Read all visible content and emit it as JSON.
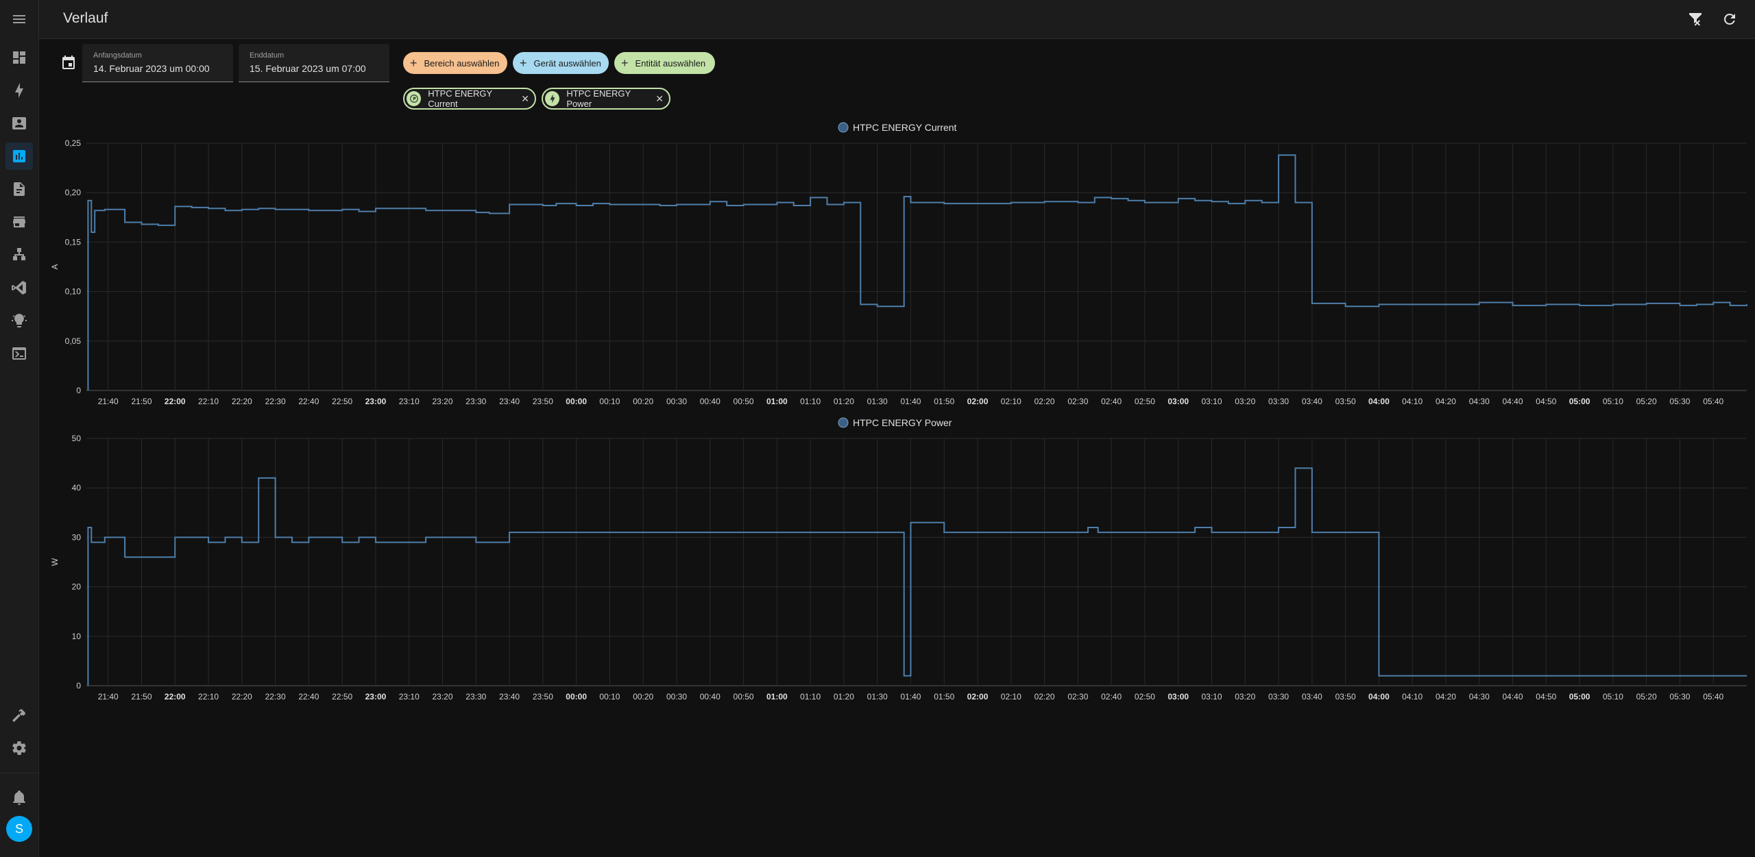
{
  "header": {
    "title": "Verlauf"
  },
  "sidebar": {
    "items": [
      {
        "name": "sidebar-item-overview",
        "icon": "dashboard-icon"
      },
      {
        "name": "sidebar-item-energy",
        "icon": "lightning-icon"
      },
      {
        "name": "sidebar-item-logbook",
        "icon": "account-box-icon"
      },
      {
        "name": "sidebar-item-history",
        "icon": "chart-box-icon",
        "active": true
      },
      {
        "name": "sidebar-item-file-editor",
        "icon": "file-document-icon"
      },
      {
        "name": "sidebar-item-store",
        "icon": "store-icon"
      },
      {
        "name": "sidebar-item-network",
        "icon": "sitemap-icon"
      },
      {
        "name": "sidebar-item-vscode",
        "icon": "code-icon"
      },
      {
        "name": "sidebar-item-lights",
        "icon": "lightbulb-icon"
      },
      {
        "name": "sidebar-item-terminal",
        "icon": "terminal-icon"
      }
    ],
    "bottom": [
      {
        "name": "sidebar-item-developer-tools",
        "icon": "hammer-icon"
      },
      {
        "name": "sidebar-item-settings",
        "icon": "gear-icon"
      },
      {
        "name": "sidebar-item-notifications",
        "icon": "bell-icon"
      }
    ],
    "user_initial": "S"
  },
  "dates": {
    "start_label": "Anfangsdatum",
    "start_value": "14. Februar 2023 um 00:00",
    "end_label": "Enddatum",
    "end_value": "15. Februar 2023 um 07:00"
  },
  "targets": {
    "area_label": "Bereich auswählen",
    "device_label": "Gerät auswählen",
    "entity_label": "Entität auswählen",
    "selected": [
      "HTPC ENERGY Current",
      "HTPC ENERGY Power"
    ]
  },
  "colors": {
    "accent": "#03a9f4",
    "series": "#4e7fab",
    "chip_area": "#f6c08f",
    "chip_device": "#a7d9f0",
    "chip_entity": "#c3e2a7"
  },
  "chart_data": [
    {
      "type": "line",
      "step": true,
      "legend": "HTPC ENERGY Current",
      "ylabel": "A",
      "ylim": [
        0,
        0.25
      ],
      "yticks": [
        "0",
        "0,05",
        "0,10",
        "0,15",
        "0,20",
        "0,25"
      ],
      "xticks": [
        "21:40",
        "21:50",
        "22:00",
        "22:10",
        "22:20",
        "22:30",
        "22:40",
        "22:50",
        "23:00",
        "23:10",
        "23:20",
        "23:30",
        "23:40",
        "23:50",
        "00:00",
        "00:10",
        "00:20",
        "00:30",
        "00:40",
        "00:50",
        "01:00",
        "01:10",
        "01:20",
        "01:30",
        "01:40",
        "01:50",
        "02:00",
        "02:10",
        "02:20",
        "02:30",
        "02:40",
        "02:50",
        "03:00",
        "03:10",
        "03:20",
        "03:30",
        "03:40",
        "03:50",
        "04:00",
        "04:10",
        "04:20",
        "04:30",
        "04:40",
        "04:50",
        "05:00",
        "05:10",
        "05:20",
        "05:30",
        "05:40"
      ],
      "x": [
        "21:34",
        "21:34",
        "21:35",
        "21:35",
        "21:36",
        "21:36",
        "21:39",
        "21:45",
        "21:50",
        "21:55",
        "22:00",
        "22:05",
        "22:10",
        "22:15",
        "22:20",
        "22:25",
        "22:30",
        "22:40",
        "22:50",
        "22:55",
        "23:00",
        "23:15",
        "23:20",
        "23:30",
        "23:34",
        "23:40",
        "23:50",
        "23:54",
        "24:00",
        "24:05",
        "24:10",
        "24:15",
        "24:20",
        "24:25",
        "24:30",
        "24:40",
        "24:45",
        "24:50",
        "25:00",
        "25:05",
        "25:10",
        "25:15",
        "25:20",
        "25:25",
        "25:30",
        "25:38",
        "25:40",
        "25:47",
        "25:50",
        "26:00",
        "26:10",
        "26:20",
        "26:30",
        "26:35",
        "26:40",
        "26:45",
        "26:50",
        "27:00",
        "27:05",
        "27:10",
        "27:15",
        "27:20",
        "27:25",
        "27:30",
        "27:35",
        "27:38",
        "27:40",
        "27:50",
        "28:00",
        "28:10",
        "28:20",
        "28:30",
        "28:40",
        "28:50",
        "29:00",
        "29:10",
        "29:20",
        "29:30",
        "29:35",
        "29:40",
        "29:45",
        "29:50"
      ],
      "y": [
        0,
        0.192,
        0.183,
        0.16,
        0.182,
        0.182,
        0.183,
        0.17,
        0.168,
        0.167,
        0.186,
        0.185,
        0.184,
        0.182,
        0.183,
        0.184,
        0.183,
        0.182,
        0.183,
        0.181,
        0.184,
        0.182,
        0.182,
        0.18,
        0.179,
        0.188,
        0.187,
        0.189,
        0.187,
        0.189,
        0.188,
        0.188,
        0.188,
        0.187,
        0.188,
        0.191,
        0.187,
        0.188,
        0.19,
        0.187,
        0.195,
        0.188,
        0.19,
        0.087,
        0.085,
        0.196,
        0.19,
        0.19,
        0.189,
        0.189,
        0.19,
        0.191,
        0.19,
        0.195,
        0.194,
        0.192,
        0.19,
        0.194,
        0.192,
        0.191,
        0.189,
        0.192,
        0.19,
        0.238,
        0.19,
        0.19,
        0.088,
        0.085,
        0.087,
        0.087,
        0.087,
        0.089,
        0.086,
        0.087,
        0.086,
        0.087,
        0.088,
        0.086,
        0.087,
        0.089,
        0.086,
        0.087
      ]
    },
    {
      "type": "line",
      "step": true,
      "legend": "HTPC ENERGY Power",
      "ylabel": "W",
      "ylim": [
        0,
        50
      ],
      "yticks": [
        "0",
        "10",
        "20",
        "30",
        "40",
        "50"
      ],
      "xticks": [
        "21:40",
        "21:50",
        "22:00",
        "22:10",
        "22:20",
        "22:30",
        "22:40",
        "22:50",
        "23:00",
        "23:10",
        "23:20",
        "23:30",
        "23:40",
        "23:50",
        "00:00",
        "00:10",
        "00:20",
        "00:30",
        "00:40",
        "00:50",
        "01:00",
        "01:10",
        "01:20",
        "01:30",
        "01:40",
        "01:50",
        "02:00",
        "02:10",
        "02:20",
        "02:30",
        "02:40",
        "02:50",
        "03:00",
        "03:10",
        "03:20",
        "03:30",
        "03:40",
        "03:50",
        "04:00",
        "04:10",
        "04:20",
        "04:30",
        "04:40",
        "04:50",
        "05:00",
        "05:10",
        "05:20",
        "05:30",
        "05:40"
      ],
      "x": [
        "21:34",
        "21:34",
        "21:35",
        "21:35",
        "21:36",
        "21:39",
        "21:45",
        "21:50",
        "22:00",
        "22:10",
        "22:15",
        "22:20",
        "22:25",
        "22:30",
        "22:35",
        "22:40",
        "22:50",
        "22:55",
        "23:00",
        "23:05",
        "23:15",
        "23:20",
        "23:30",
        "23:40",
        "24:00",
        "25:00",
        "25:20",
        "25:25",
        "25:38",
        "25:40",
        "25:43",
        "25:50",
        "26:00",
        "26:20",
        "26:33",
        "26:36",
        "26:40",
        "27:00",
        "27:05",
        "27:10",
        "27:15",
        "27:25",
        "27:30",
        "27:35",
        "27:40",
        "28:00",
        "29:00",
        "29:50"
      ],
      "y": [
        0,
        32,
        30,
        29,
        29,
        30,
        26,
        26,
        30,
        29,
        30,
        29,
        42,
        30,
        29,
        30,
        29,
        30,
        29,
        29,
        30,
        30,
        29,
        31,
        31,
        31,
        31,
        31,
        2,
        33,
        33,
        31,
        31,
        31,
        32,
        31,
        31,
        31,
        32,
        31,
        31,
        31,
        32,
        44,
        31,
        2,
        2,
        2
      ]
    }
  ]
}
